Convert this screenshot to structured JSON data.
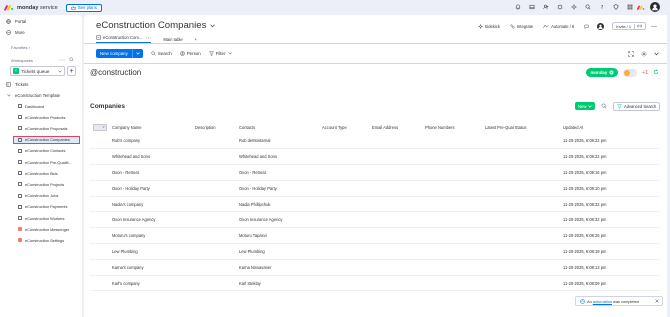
{
  "topbar": {
    "brand": "monday",
    "brand_sub": " service",
    "see_plans": "See plans"
  },
  "sidebar": {
    "portal": "Portal",
    "more": "More",
    "favorites": "Favorites",
    "workspaces": "Workspaces",
    "workspace_badge": "T",
    "workspace_name": "Tickets queue",
    "tickets": "Tickets",
    "folder": "eConstruction Template",
    "items": [
      {
        "label": "Dashboard",
        "icon": "board-icon"
      },
      {
        "label": "eConstruction Products",
        "icon": "board-icon"
      },
      {
        "label": "eConstruction Proposals",
        "icon": "board-icon"
      },
      {
        "label": "eConstruction Companies",
        "icon": "board-icon"
      },
      {
        "label": "eConstruction Contacts",
        "icon": "board-icon"
      },
      {
        "label": "eConstruction Pre-Qualifi...",
        "icon": "board-icon"
      },
      {
        "label": "eConstruction Bids",
        "icon": "board-icon"
      },
      {
        "label": "eConstruction Projects",
        "icon": "board-icon"
      },
      {
        "label": "eConstruction Jobs",
        "icon": "board-icon"
      },
      {
        "label": "eConstruction Payments",
        "icon": "board-icon"
      },
      {
        "label": "eConstruction Workers",
        "icon": "board-icon"
      },
      {
        "label": "eConstruction Messenger",
        "icon": "app-icon"
      },
      {
        "label": "eConstruction Settings",
        "icon": "app-icon"
      }
    ]
  },
  "board": {
    "title": "eConstruction Companies",
    "actions": {
      "sidekick": "Sidekick",
      "integrate": "Integrate",
      "automate": "Automate / 6",
      "invite": "Invite / 1"
    },
    "views": {
      "app_view": "eConstruction Com...",
      "main_table": "Main table"
    },
    "toolbar": {
      "new_button": "New company",
      "search": "Search",
      "person": "Person",
      "filter": "Filter"
    }
  },
  "app": {
    "brand": "@construction",
    "monday_pill": "monday",
    "plus_one": "+1",
    "table_title": "Companies",
    "new_label": "New",
    "advanced_search": "Advanced Search",
    "columns": [
      "Company Name",
      "Description",
      "Contacts",
      "Account Type",
      "Email Address",
      "Phone Numbers",
      "Latest Pre-Qual Status",
      "Updated At"
    ],
    "rows": [
      {
        "company": "Rob's company",
        "description": "",
        "contacts": "Rob deMontarnal",
        "account_type": "",
        "email": "",
        "phone": "",
        "status": "",
        "updated": "11-20-2025, 6:09:22 pm"
      },
      {
        "company": "Whitehead and Sons",
        "description": "",
        "contacts": "Whitehead and Sons",
        "account_type": "",
        "email": "",
        "phone": "",
        "status": "",
        "updated": "11-20-2025, 6:09:22 pm"
      },
      {
        "company": "Oxon - Retreat",
        "description": "",
        "contacts": "Oxon - Retreat",
        "account_type": "",
        "email": "",
        "phone": "",
        "status": "",
        "updated": "11-20-2025, 6:09:16 pm"
      },
      {
        "company": "Oxon - Holiday Party",
        "description": "",
        "contacts": "Oxon - Holiday Party",
        "account_type": "",
        "email": "",
        "phone": "",
        "status": "",
        "updated": "11-20-2025, 6:09:10 pm"
      },
      {
        "company": "Nadia's company",
        "description": "",
        "contacts": "Nadia Phillipchuk",
        "account_type": "",
        "email": "",
        "phone": "",
        "status": "",
        "updated": "11-20-2025, 6:08:32 pm"
      },
      {
        "company": "Oxon Insurance Agency",
        "description": "",
        "contacts": "Oxon Insurance Agency",
        "account_type": "",
        "email": "",
        "phone": "",
        "status": "",
        "updated": "11-20-2025, 6:08:32 pm"
      },
      {
        "company": "Moturu's company",
        "description": "",
        "contacts": "Moturu Tapasvi",
        "account_type": "",
        "email": "",
        "phone": "",
        "status": "",
        "updated": "11-20-2025, 6:08:26 pm"
      },
      {
        "company": "Lew Plumbing",
        "description": "",
        "contacts": "Lew Plumbing",
        "account_type": "",
        "email": "",
        "phone": "",
        "status": "",
        "updated": "11-20-2025, 6:08:19 pm"
      },
      {
        "company": "Karna's company",
        "description": "",
        "contacts": "Karna Nissavaner",
        "account_type": "",
        "email": "",
        "phone": "",
        "status": "",
        "updated": "11-20-2025, 6:08:13 pm"
      },
      {
        "company": "Karl's company",
        "description": "",
        "contacts": "Karl Steklay",
        "account_type": "",
        "email": "",
        "phone": "",
        "status": "",
        "updated": "11-20-2025, 6:08:09 pm"
      }
    ]
  },
  "toast": {
    "prefix": "An",
    "link": "automation",
    "suffix": "was completed"
  },
  "colors": {
    "accent": "#0073ea",
    "green": "#00ca72",
    "selected_border": "#e2445c"
  }
}
